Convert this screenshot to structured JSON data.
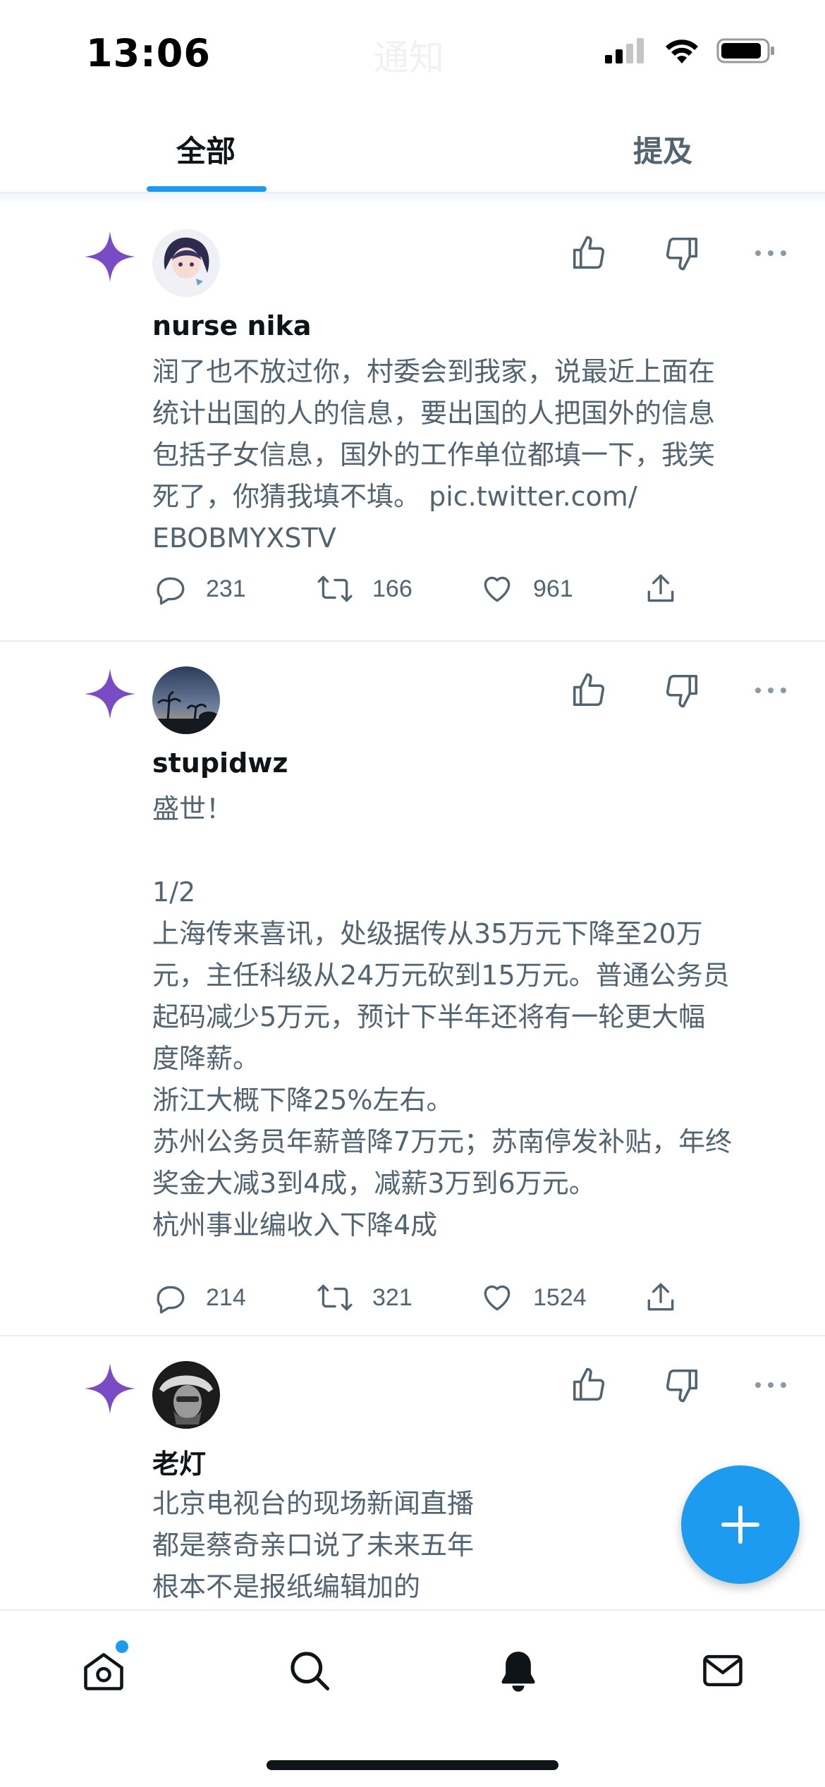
{
  "status_bar": {
    "time": "13:06",
    "header_title": "通知"
  },
  "tabs": [
    {
      "label": "全部",
      "active": true
    },
    {
      "label": "提及",
      "active": false
    }
  ],
  "tweets": [
    {
      "author": "nurse nika",
      "text": "润了也不放过你，村委会到我家，说最近上面在\n统计出国的人的信息，要出国的人把国外的信息\n包括子女信息，国外的工作单位都填一下，我笑\n死了，你猜我填不填。 pic.twitter.com/\nEBOBMYXSTV",
      "replies": "231",
      "retweets": "166",
      "likes": "961"
    },
    {
      "author": "stupidwz",
      "text": "盛世！\n\n1/2\n上海传来喜讯，处级据传从35万元下降至20万\n元，主任科级从24万元砍到15万元。普通公务员\n起码减少5万元，预计下半年还将有一轮更大幅\n度降薪。\n浙江大概下降25%左右。\n苏州公务员年薪普降7万元；苏南停发补贴，年终\n奖金大减3到4成，减薪3万到6万元。\n杭州事业编收入下降4成",
      "replies": "214",
      "retweets": "321",
      "likes": "1524"
    },
    {
      "author": "老灯",
      "text": "北京电视台的现场新闻直播\n都是蔡奇亲口说了未来五年\n根本不是报纸编辑加的"
    }
  ],
  "colors": {
    "accent": "#1d9bf0",
    "sparkle": "#794bc4",
    "text_primary": "#0f1419",
    "text_secondary": "#536471",
    "divider": "#e6ecf0"
  },
  "icons": {
    "sparkle": "sparkle-icon",
    "like": "thumbs-up-icon",
    "dislike": "thumbs-down-icon",
    "more": "more-icon",
    "reply": "reply-icon",
    "retweet": "retweet-icon",
    "heart": "heart-icon",
    "share": "share-icon",
    "compose": "plus-icon",
    "home": "home-icon",
    "search": "search-icon",
    "notifications": "bell-icon",
    "messages": "mail-icon"
  }
}
